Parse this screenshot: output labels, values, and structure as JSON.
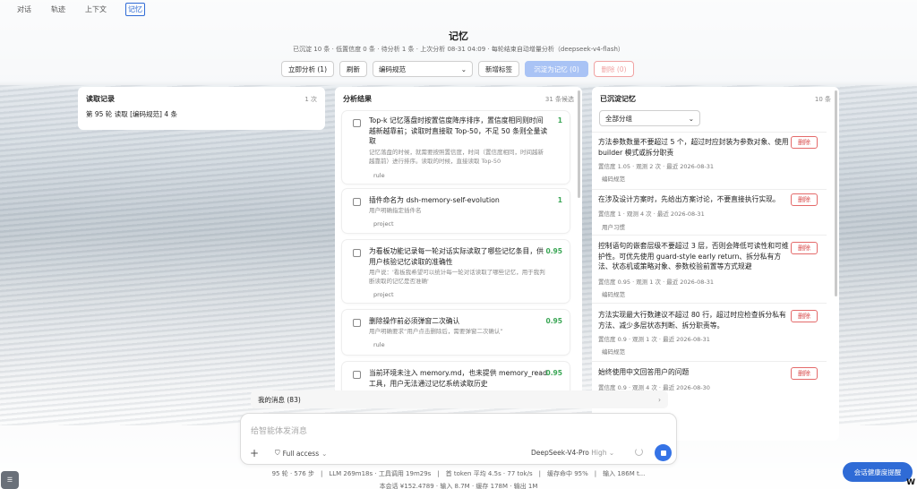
{
  "tabs": [
    "对话",
    "轨迹",
    "上下文",
    "记忆"
  ],
  "page": {
    "title": "记忆",
    "subtitle": "已沉淀 10 条 · 低置信度 0 条 · 待分析 1 条 · 上次分析 08-31 04:09 · 每轮结束自动增量分析（deepseek-v4-flash）"
  },
  "toolbar": {
    "analyze": "立即分析 (1)",
    "refresh": "刷新",
    "select": "编码规范",
    "add_tag": "新增标签",
    "deposit": "沉淀为记忆 (0)",
    "delete": "删除 (0)"
  },
  "read_log": {
    "title": "读取记录",
    "count": "1 次",
    "entry": "第 95 轮 读取 [编码规范] 4 条"
  },
  "analysis": {
    "title": "分析结果",
    "count": "31 条候选",
    "items": [
      {
        "title": "Top-k 记忆落盘时按置信度降序排序，置信度相同则时间越新越靠前；读取时直接取 Top-50，不足 50 条则全量读取",
        "score": "1",
        "desc": "记忆落盘的时候，就需要按照置信度，时间（置信度相同，时间越新越靠前）进行排序。读取的时候，直接读取 Top-50",
        "tag": "rule"
      },
      {
        "title": "插件命名为 dsh-memory-self-evolution",
        "score": "1",
        "desc": "用户明确指定插件名",
        "tag": "project"
      },
      {
        "title": "为看板功能记录每一轮对话实际读取了哪些记忆条目，供用户核验记忆读取的准确性",
        "score": "0.95",
        "desc": "用户说：'看板我希望可以统计每一轮对话读取了哪些记忆，用于我判断读取的记忆是否准确'",
        "tag": "project"
      },
      {
        "title": "删除操作前必须弹窗二次确认",
        "score": "0.95",
        "desc": "用户明确要求“用户点击删除后，需要弹窗二次确认”",
        "tag": "rule"
      },
      {
        "title": "当前环境未注入 memory.md，也未提供 memory_read 工具，用户无法通过记忆系统读取历史",
        "score": "0.95",
        "desc": "",
        "tag": ""
      }
    ]
  },
  "memories": {
    "title": "已沉淀记忆",
    "count": "10 条",
    "filter": "全部分组",
    "delete_label": "删除",
    "items": [
      {
        "title": "方法参数数量不要超过 5 个，超过时应封装为参数对象、使用 builder 模式或拆分职责",
        "meta": "置信度 1.05 · 观测 2 次 · 最近 2026-08-31",
        "tag": "编码规范"
      },
      {
        "title": "在涉及设计方案时，先给出方案讨论，不要直接执行实现。",
        "meta": "置信度 1 · 观测 4 次 · 最近 2026-08-31",
        "tag": "用户习惯"
      },
      {
        "title": "控制语句的嵌套层级不要超过 3 层，否则会降低可读性和可维护性。可优先使用 guard-style early return、拆分私有方法、状态机或策略对象、参数校验前置等方式规避",
        "meta": "置信度 0.95 · 观测 1 次 · 最近 2026-08-31",
        "tag": "编码规范"
      },
      {
        "title": "方法实现最大行数建议不超过 80 行，超过时应检查拆分私有方法、减少多层状态判断、拆分职责等。",
        "meta": "置信度 0.9 · 观测 1 次 · 最近 2026-08-31",
        "tag": "编码规范"
      },
      {
        "title": "始终使用中文回答用户的问题",
        "meta": "置信度 0.9 · 观测 4 次 · 最近 2026-08-30",
        "tag": ""
      }
    ]
  },
  "chat": {
    "my_messages": "我的消息 (83)",
    "placeholder": "给智能体发消息",
    "access": "Full access",
    "model": "DeepSeek-V4-Pro",
    "effort": "High"
  },
  "status": {
    "line1": "95 轮 · 576 步　|　LLM 269m18s · 工具调用 19m29s　|　首 token 平均 4.5s · 77 tok/s　|　缓存命中 95%　|　输入 186M t...",
    "line2": "本会话 ¥152.4789 · 输入 8.7M · 缓存 178M · 输出 1M"
  },
  "health_button": "会话健康度提醒"
}
